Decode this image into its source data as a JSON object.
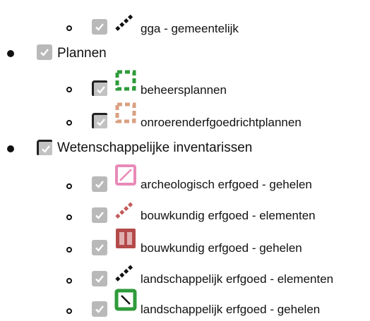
{
  "tree": {
    "gga": {
      "label": "gga - gemeentelijk",
      "checked": true,
      "symbol": "line-black"
    },
    "plannen": {
      "label": "Plannen",
      "checked": true,
      "children": [
        {
          "label": "beheersplannen",
          "checked": true,
          "symbol": "dashed-square-green"
        },
        {
          "label": "onroerenderfgoedrichtplannen",
          "checked": true,
          "symbol": "dashed-square-salmon"
        }
      ]
    },
    "wetenschappelijke": {
      "label": "Wetenschappelijke inventarissen",
      "checked": true,
      "children": [
        {
          "label": "archeologisch erfgoed - gehelen",
          "checked": true,
          "symbol": "pink-square-diagonal"
        },
        {
          "label": "bouwkundig erfgoed - elementen",
          "checked": true,
          "symbol": "line-red"
        },
        {
          "label": "bouwkundig erfgoed - gehelen",
          "checked": true,
          "symbol": "red-square-bars"
        },
        {
          "label": "landschappelijk erfgoed - elementen",
          "checked": true,
          "symbol": "line-black"
        },
        {
          "label": "landschappelijk erfgoed - gehelen",
          "checked": true,
          "symbol": "green-square-diagonal"
        }
      ]
    }
  },
  "colors": {
    "checkbox": "#b9b9b9",
    "green": "#2f9b3a",
    "salmon": "#d9a081",
    "pink": "#e88ab8",
    "red": "#b54a4a"
  }
}
